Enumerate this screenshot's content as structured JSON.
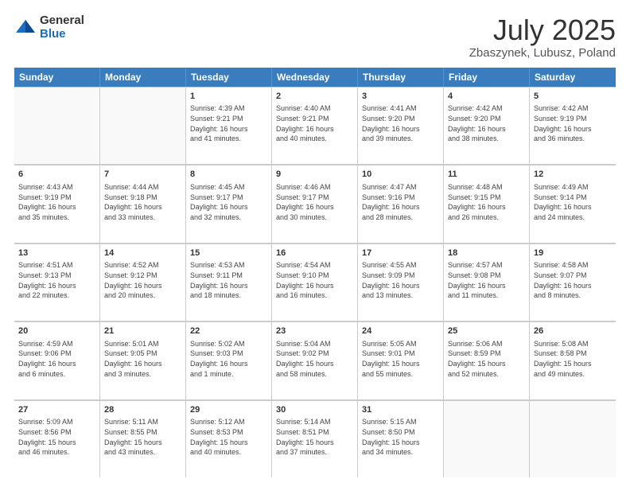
{
  "logo": {
    "general": "General",
    "blue": "Blue"
  },
  "title": "July 2025",
  "subtitle": "Zbaszynek, Lubusz, Poland",
  "days": [
    "Sunday",
    "Monday",
    "Tuesday",
    "Wednesday",
    "Thursday",
    "Friday",
    "Saturday"
  ],
  "weeks": [
    [
      {
        "day": "",
        "info": ""
      },
      {
        "day": "",
        "info": ""
      },
      {
        "day": "1",
        "info": "Sunrise: 4:39 AM\nSunset: 9:21 PM\nDaylight: 16 hours\nand 41 minutes."
      },
      {
        "day": "2",
        "info": "Sunrise: 4:40 AM\nSunset: 9:21 PM\nDaylight: 16 hours\nand 40 minutes."
      },
      {
        "day": "3",
        "info": "Sunrise: 4:41 AM\nSunset: 9:20 PM\nDaylight: 16 hours\nand 39 minutes."
      },
      {
        "day": "4",
        "info": "Sunrise: 4:42 AM\nSunset: 9:20 PM\nDaylight: 16 hours\nand 38 minutes."
      },
      {
        "day": "5",
        "info": "Sunrise: 4:42 AM\nSunset: 9:19 PM\nDaylight: 16 hours\nand 36 minutes."
      }
    ],
    [
      {
        "day": "6",
        "info": "Sunrise: 4:43 AM\nSunset: 9:19 PM\nDaylight: 16 hours\nand 35 minutes."
      },
      {
        "day": "7",
        "info": "Sunrise: 4:44 AM\nSunset: 9:18 PM\nDaylight: 16 hours\nand 33 minutes."
      },
      {
        "day": "8",
        "info": "Sunrise: 4:45 AM\nSunset: 9:17 PM\nDaylight: 16 hours\nand 32 minutes."
      },
      {
        "day": "9",
        "info": "Sunrise: 4:46 AM\nSunset: 9:17 PM\nDaylight: 16 hours\nand 30 minutes."
      },
      {
        "day": "10",
        "info": "Sunrise: 4:47 AM\nSunset: 9:16 PM\nDaylight: 16 hours\nand 28 minutes."
      },
      {
        "day": "11",
        "info": "Sunrise: 4:48 AM\nSunset: 9:15 PM\nDaylight: 16 hours\nand 26 minutes."
      },
      {
        "day": "12",
        "info": "Sunrise: 4:49 AM\nSunset: 9:14 PM\nDaylight: 16 hours\nand 24 minutes."
      }
    ],
    [
      {
        "day": "13",
        "info": "Sunrise: 4:51 AM\nSunset: 9:13 PM\nDaylight: 16 hours\nand 22 minutes."
      },
      {
        "day": "14",
        "info": "Sunrise: 4:52 AM\nSunset: 9:12 PM\nDaylight: 16 hours\nand 20 minutes."
      },
      {
        "day": "15",
        "info": "Sunrise: 4:53 AM\nSunset: 9:11 PM\nDaylight: 16 hours\nand 18 minutes."
      },
      {
        "day": "16",
        "info": "Sunrise: 4:54 AM\nSunset: 9:10 PM\nDaylight: 16 hours\nand 16 minutes."
      },
      {
        "day": "17",
        "info": "Sunrise: 4:55 AM\nSunset: 9:09 PM\nDaylight: 16 hours\nand 13 minutes."
      },
      {
        "day": "18",
        "info": "Sunrise: 4:57 AM\nSunset: 9:08 PM\nDaylight: 16 hours\nand 11 minutes."
      },
      {
        "day": "19",
        "info": "Sunrise: 4:58 AM\nSunset: 9:07 PM\nDaylight: 16 hours\nand 8 minutes."
      }
    ],
    [
      {
        "day": "20",
        "info": "Sunrise: 4:59 AM\nSunset: 9:06 PM\nDaylight: 16 hours\nand 6 minutes."
      },
      {
        "day": "21",
        "info": "Sunrise: 5:01 AM\nSunset: 9:05 PM\nDaylight: 16 hours\nand 3 minutes."
      },
      {
        "day": "22",
        "info": "Sunrise: 5:02 AM\nSunset: 9:03 PM\nDaylight: 16 hours\nand 1 minute."
      },
      {
        "day": "23",
        "info": "Sunrise: 5:04 AM\nSunset: 9:02 PM\nDaylight: 15 hours\nand 58 minutes."
      },
      {
        "day": "24",
        "info": "Sunrise: 5:05 AM\nSunset: 9:01 PM\nDaylight: 15 hours\nand 55 minutes."
      },
      {
        "day": "25",
        "info": "Sunrise: 5:06 AM\nSunset: 8:59 PM\nDaylight: 15 hours\nand 52 minutes."
      },
      {
        "day": "26",
        "info": "Sunrise: 5:08 AM\nSunset: 8:58 PM\nDaylight: 15 hours\nand 49 minutes."
      }
    ],
    [
      {
        "day": "27",
        "info": "Sunrise: 5:09 AM\nSunset: 8:56 PM\nDaylight: 15 hours\nand 46 minutes."
      },
      {
        "day": "28",
        "info": "Sunrise: 5:11 AM\nSunset: 8:55 PM\nDaylight: 15 hours\nand 43 minutes."
      },
      {
        "day": "29",
        "info": "Sunrise: 5:12 AM\nSunset: 8:53 PM\nDaylight: 15 hours\nand 40 minutes."
      },
      {
        "day": "30",
        "info": "Sunrise: 5:14 AM\nSunset: 8:51 PM\nDaylight: 15 hours\nand 37 minutes."
      },
      {
        "day": "31",
        "info": "Sunrise: 5:15 AM\nSunset: 8:50 PM\nDaylight: 15 hours\nand 34 minutes."
      },
      {
        "day": "",
        "info": ""
      },
      {
        "day": "",
        "info": ""
      }
    ]
  ]
}
